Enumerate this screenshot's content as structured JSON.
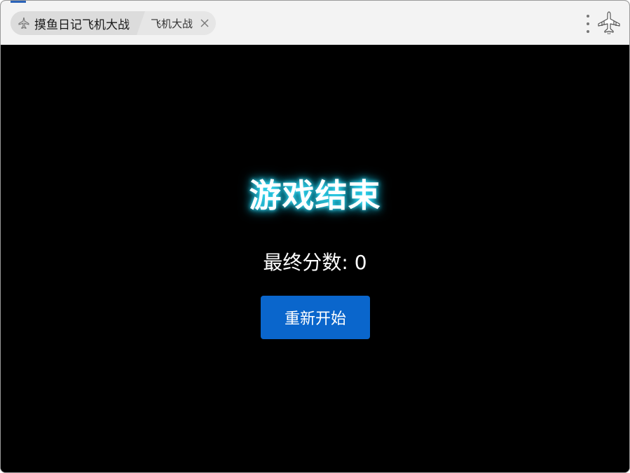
{
  "window": {
    "tabs": [
      {
        "label": "摸鱼日记飞机大战",
        "icon": "fighter-jet-icon"
      },
      {
        "label": "飞机大战",
        "close_icon": "close-icon"
      }
    ],
    "menu_icon": "more-vertical-icon",
    "logo_icon": "fighter-jet-logo-icon"
  },
  "game_over": {
    "title": "游戏结束",
    "score_label": "最终分数: 0",
    "restart_label": "重新开始"
  },
  "colors": {
    "titlebar_bg": "#f3f3f3",
    "game_bg": "#000000",
    "title_glow": "#3fe6ff",
    "button_bg": "#0a66cc",
    "button_text": "#ffffff"
  }
}
